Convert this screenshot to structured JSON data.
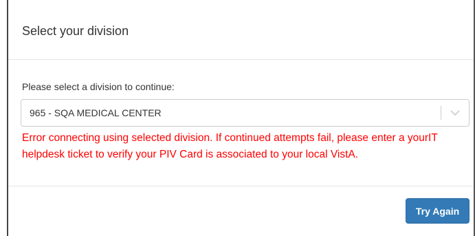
{
  "modal": {
    "title": "Select your division",
    "prompt_label": "Please select a division to continue:",
    "division_select": {
      "selected_value": "965 - SQA MEDICAL CENTER",
      "arrow_icon": "chevron-down-icon"
    },
    "error_message": "Error connecting using selected division. If continued attempts fail, please enter a yourIT helpdesk ticket to verify your PIV Card is associated to your local VistA.",
    "error_color": "#ff0000",
    "try_again_label": "Try Again",
    "button_color": "#337ab7"
  }
}
